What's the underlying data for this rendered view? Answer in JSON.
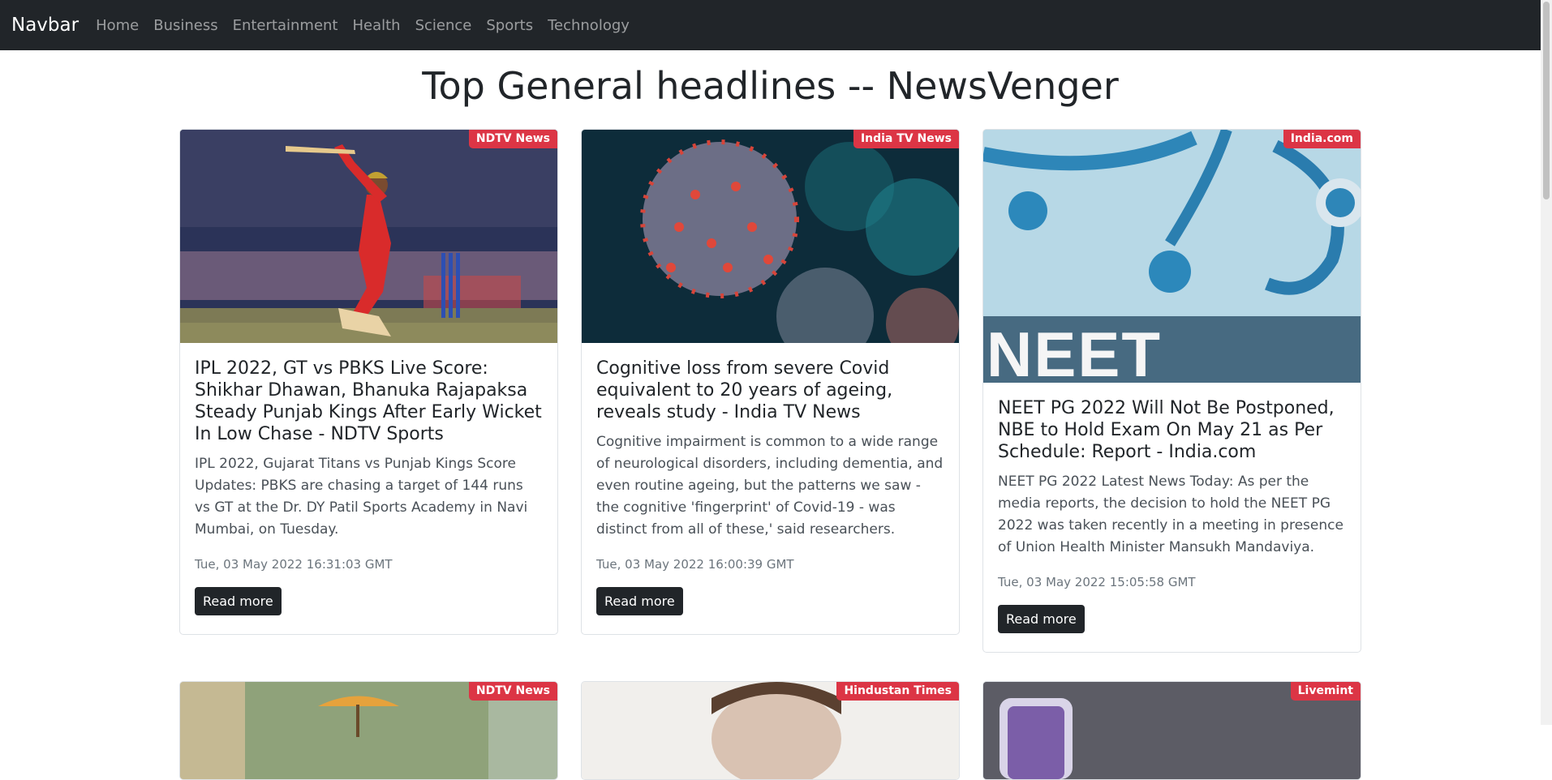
{
  "navbar": {
    "brand": "Navbar",
    "links": [
      "Home",
      "Business",
      "Entertainment",
      "Health",
      "Science",
      "Sports",
      "Technology"
    ]
  },
  "page": {
    "title": "Top General headlines -- NewsVenger"
  },
  "articles": [
    {
      "source": "NDTV News",
      "title": "IPL 2022, GT vs PBKS Live Score: Shikhar Dhawan, Bhanuka Rajapaksa Steady Punjab Kings After Early Wicket In Low Chase - NDTV Sports",
      "description": "IPL 2022, Gujarat Titans vs Punjab Kings Score Updates: PBKS are chasing a target of 144 runs vs GT at the Dr. DY Patil Sports Academy in Navi Mumbai, on Tuesday.",
      "date": "Tue, 03 May 2022 16:31:03 GMT",
      "button": "Read more"
    },
    {
      "source": "India TV News",
      "title": "Cognitive loss from severe Covid equivalent to 20 years of ageing, reveals study - India TV News",
      "description": "Cognitive impairment is common to a wide range of neurological disorders, including dementia, and even routine ageing, but the patterns we saw - the cognitive 'fingerprint' of Covid-19 - was distinct from all of these,' said researchers.",
      "date": "Tue, 03 May 2022 16:00:39 GMT",
      "button": "Read more"
    },
    {
      "source": "India.com",
      "image_text": "NEET",
      "title": "NEET PG 2022 Will Not Be Postponed, NBE to Hold Exam On May 21 as Per Schedule: Report - India.com",
      "description": "NEET PG 2022 Latest News Today: As per the media reports, the decision to hold the NEET PG 2022 was taken recently in a meeting in presence of Union Health Minister Mansukh Mandaviya.",
      "date": "Tue, 03 May 2022 15:05:58 GMT",
      "button": "Read more"
    },
    {
      "source": "NDTV News"
    },
    {
      "source": "Hindustan Times"
    },
    {
      "source": "Livemint"
    }
  ]
}
